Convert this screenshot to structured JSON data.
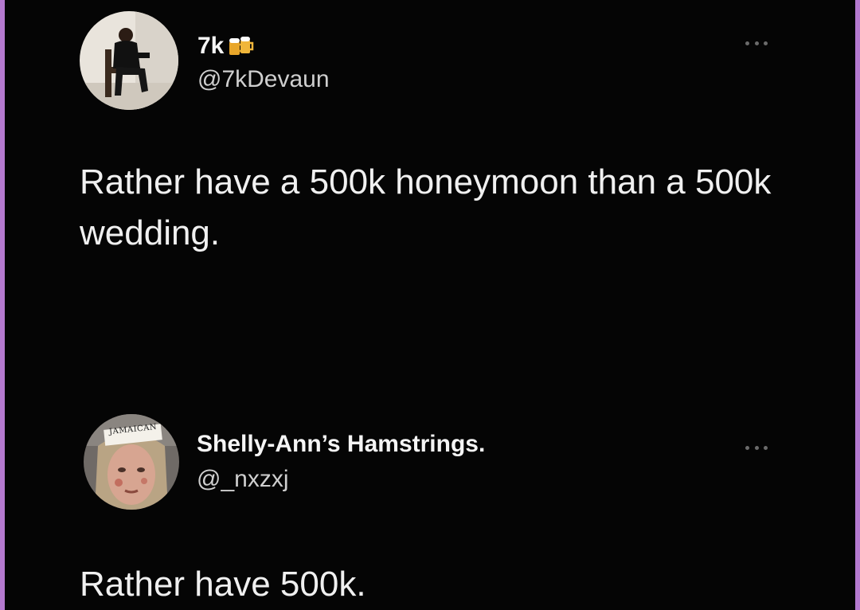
{
  "colors": {
    "background": "#050505",
    "border": "#b57ad0",
    "text_primary": "#f0f0f0",
    "text_secondary": "#cfcfcf",
    "more_dots": "#6b6b6b"
  },
  "tweets": [
    {
      "display_name": "7k",
      "name_emoji_icon": "beer-mugs-icon",
      "handle": "@7kDevaun",
      "avatar_icon": "profile-photo-man-seated",
      "more_icon": "more-options-icon",
      "text": "Rather have a 500k honeymoon than a 500k wedding."
    },
    {
      "display_name": "Shelly-Ann’s Hamstrings.",
      "handle": "@_nxzxj",
      "avatar_icon": "profile-photo-face-with-label",
      "avatar_label": "JAMAICAN",
      "more_icon": "more-options-icon",
      "text": "Rather have 500k."
    }
  ]
}
